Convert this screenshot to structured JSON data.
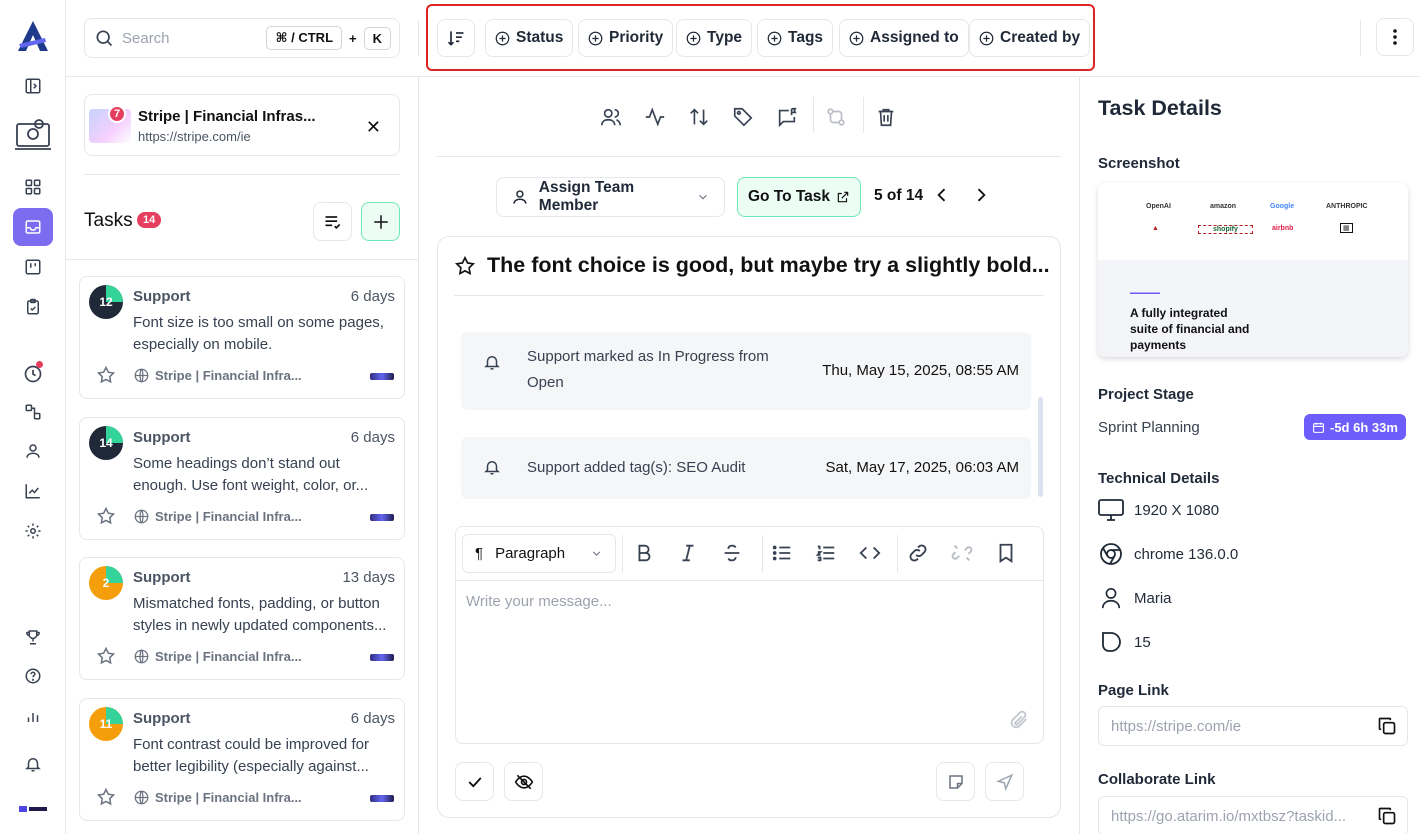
{
  "search": {
    "placeholder": "Search",
    "shortcut_mod": "⌘ / CTRL",
    "shortcut_plus": "+",
    "shortcut_key": "K"
  },
  "filters": [
    {
      "label": "Status"
    },
    {
      "label": "Priority"
    },
    {
      "label": "Type"
    },
    {
      "label": "Tags"
    },
    {
      "label": "Assigned to"
    },
    {
      "label": "Created by"
    }
  ],
  "project": {
    "name": "Stripe | Financial Infras...",
    "url": "https://stripe.com/ie",
    "badge": "7"
  },
  "tasks_panel": {
    "title": "Tasks",
    "count": "14"
  },
  "tasks": [
    {
      "num": "12",
      "type": "Support",
      "age": "6 days",
      "text": "Font size is too small on some pages, especially on mobile.",
      "site": "Stripe | Financial Infra...",
      "color": "#1f2937",
      "progress": 0.25
    },
    {
      "num": "14",
      "type": "Support",
      "age": "6 days",
      "text": "Some headings don’t stand out enough. Use font weight, color, or...",
      "site": "Stripe | Financial Infra...",
      "color": "#1f2937",
      "progress": 0.25
    },
    {
      "num": "2",
      "type": "Support",
      "age": "13 days",
      "text": "Mismatched fonts, padding, or button styles in newly updated components...",
      "site": "Stripe | Financial Infra...",
      "color": "#f59e0b",
      "progress": 0.25
    },
    {
      "num": "11",
      "type": "Support",
      "age": "6 days",
      "text": "Font contrast could be improved for better legibility (especially against...",
      "site": "Stripe | Financial Infra...",
      "color": "#f59e0b",
      "progress": 0.25
    }
  ],
  "center": {
    "assign_label": "Assign Team Member",
    "goto_label": "Go To Task",
    "pager": "5 of 14",
    "title": "The font choice is good, but maybe try a slightly bold...",
    "activities": [
      {
        "line1": "Support marked as In Progress from",
        "line2": "Open",
        "date": "Thu, May 15, 2025, 08:55 AM"
      },
      {
        "line1": "Support added tag(s): SEO Audit",
        "line2": "",
        "date": "Sat, May 17, 2025, 06:03 AM"
      }
    ],
    "editor": {
      "format": "Paragraph",
      "placeholder": "Write your message..."
    }
  },
  "details": {
    "title": "Task Details",
    "screenshot_label": "Screenshot",
    "screenshot": {
      "logos": [
        "OpenAI",
        "amazon",
        "Google",
        "ANTHROPIC",
        "shopify",
        "airbnb"
      ],
      "headline": "A fully integrated suite of financial and payments"
    },
    "stage_label": "Project Stage",
    "stage": "Sprint Planning",
    "due": "-5d 6h 33m",
    "tech_label": "Technical Details",
    "resolution": "1920 X 1080",
    "browser": "chrome 136.0.0",
    "user": "Maria",
    "tag_count": "15",
    "page_link_label": "Page Link",
    "page_link": "https://stripe.com/ie",
    "collab_label": "Collaborate Link",
    "collab_link": "https://go.atarim.io/mxtbsz?taskid..."
  },
  "colors": {
    "accent": "#7c6cf0",
    "danger": "#e53e5e",
    "success_bg": "#ecfdf5",
    "success_border": "#6ee7b7",
    "progress": "#34d399"
  }
}
